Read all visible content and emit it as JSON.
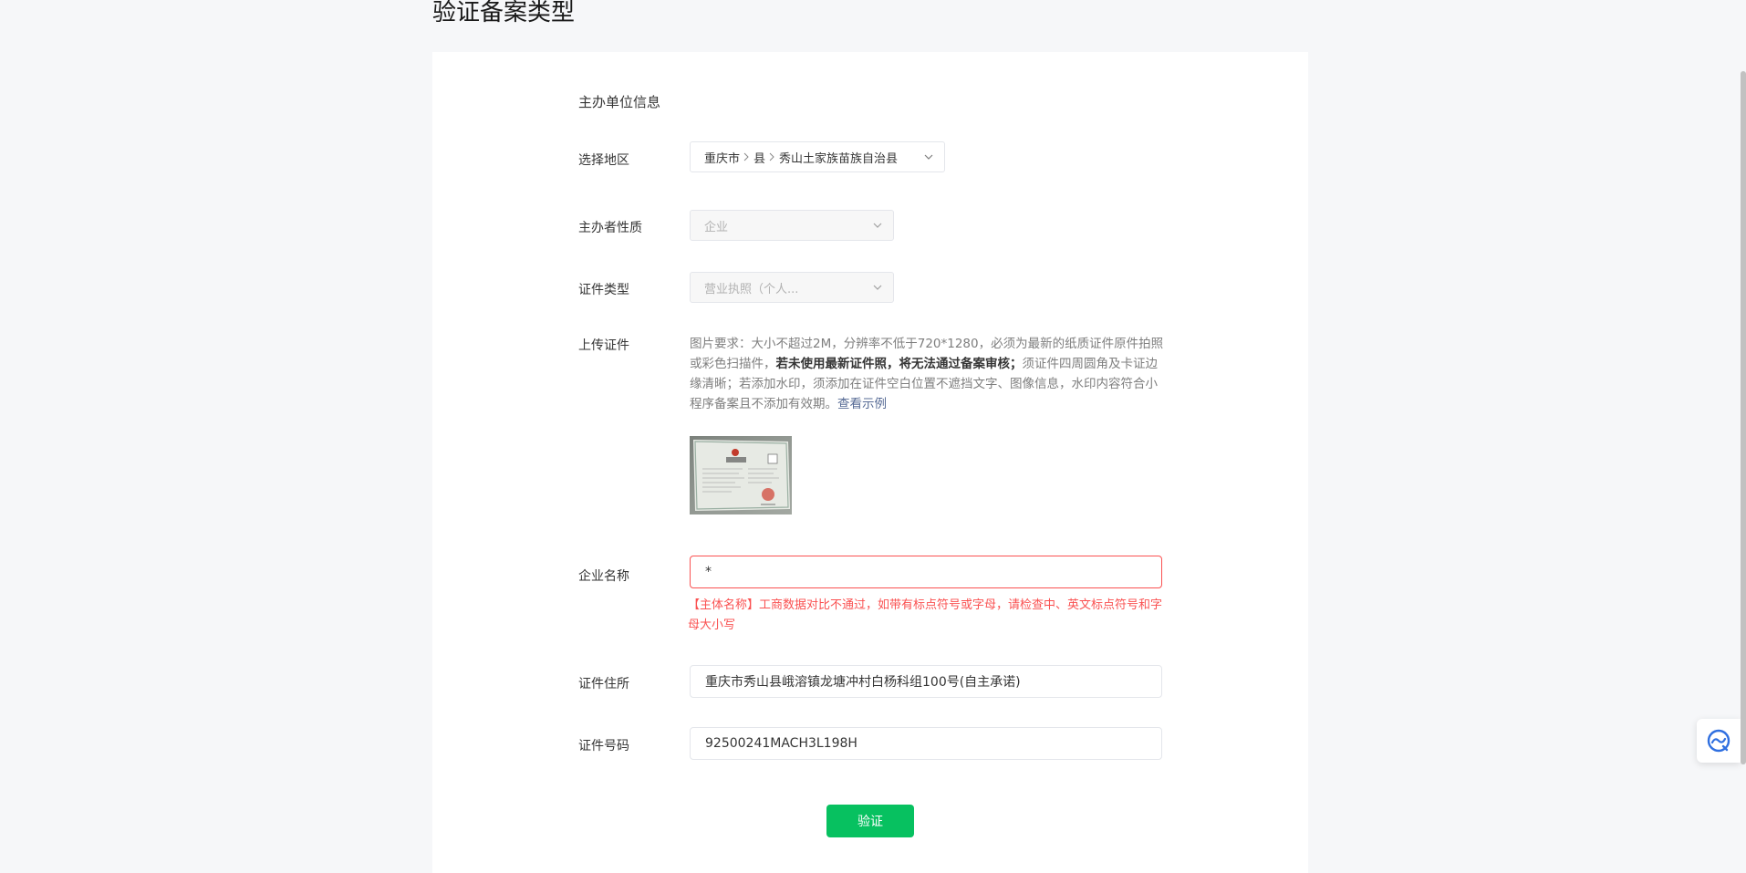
{
  "page": {
    "title": "验证备案类型"
  },
  "form": {
    "section_title": "主办单位信息",
    "region": {
      "label": "选择地区",
      "parts": [
        "重庆市",
        "县",
        "秀山土家族苗族自治县"
      ]
    },
    "sponsor_nature": {
      "label": "主办者性质",
      "value": "企业"
    },
    "cert_type": {
      "label": "证件类型",
      "value": "营业执照（个人..."
    },
    "upload": {
      "label": "上传证件",
      "desc_part1": "图片要求：大小不超过2M，分辨率不低于720*1280，必须为最新的纸质证件原件拍照或彩色扫描件，",
      "desc_bold": "若未使用最新证件照，将无法通过备案审核；",
      "desc_part2": "须证件四周圆角及卡证边缘清晰；若添加水印，须添加在证件空白位置不遮挡文字、图像信息，水印内容符合小程序备案且不添加有效期。",
      "example_link": "查看示例",
      "thumb_text": "营业执照"
    },
    "company_name": {
      "label": "企业名称",
      "value": "*",
      "error": "【主体名称】工商数据对比不通过，如带有标点符号或字母，请检查中、英文标点符号和字母大小写"
    },
    "cert_address": {
      "label": "证件住所",
      "value": "重庆市秀山县峨溶镇龙塘冲村白杨科组100号(自主承诺)"
    },
    "cert_number": {
      "label": "证件号码",
      "value": "92500241MACH3L198H"
    },
    "verify_button": "验证"
  },
  "colors": {
    "accent_green": "#07c160",
    "error_red": "#fa5151",
    "link_blue": "#576b95"
  },
  "icons": {
    "select_arrow": "chevron-down-icon",
    "region_separator": "chevron-right-icon",
    "float_widget": "customer-service-icon"
  }
}
